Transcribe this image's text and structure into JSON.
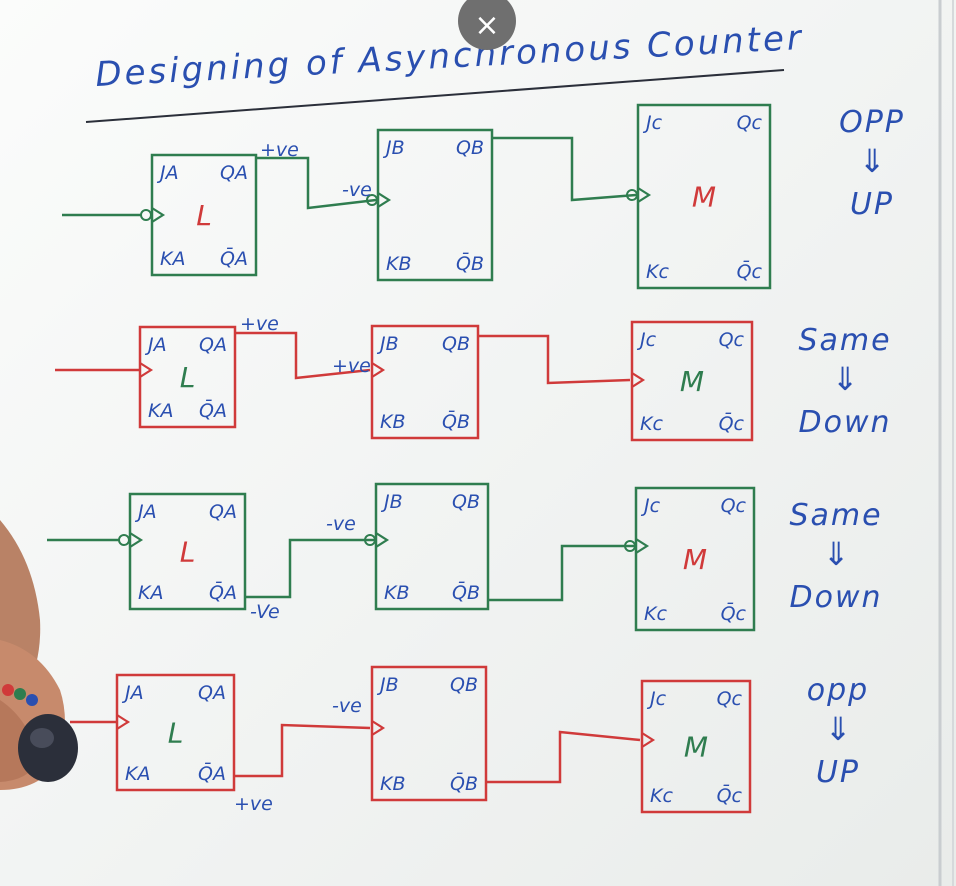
{
  "title": "Designing of Asynchronous Counter",
  "close_icon": "×",
  "colors": {
    "blue": "#2a4fb0",
    "red": "#d03a3a",
    "green": "#2f7d4f",
    "black": "#2b2f3a"
  },
  "rows": [
    {
      "color": "#2f7d4f",
      "ffA": {
        "j": "JA",
        "k": "KA",
        "q": "QA",
        "qbar": "Q̄A",
        "name": "L",
        "name_color": "#d03a3a"
      },
      "ffB": {
        "j": "JB",
        "k": "KB",
        "q": "QB",
        "qbar": "Q̄B",
        "name": "",
        "name_color": "#d03a3a"
      },
      "ffC": {
        "j": "Jc",
        "k": "Kc",
        "q": "Qc",
        "qbar": "Q̄c",
        "name": "M",
        "name_color": "#d03a3a"
      },
      "edge_label_1": "+ve",
      "edge_label_2": "-ve",
      "result_top": "OPP",
      "result_arrow": "⇓",
      "result_bottom": "UP"
    },
    {
      "color": "#d03a3a",
      "ffA": {
        "j": "JA",
        "k": "KA",
        "q": "QA",
        "qbar": "Q̄A",
        "name": "L",
        "name_color": "#2f7d4f"
      },
      "ffB": {
        "j": "JB",
        "k": "KB",
        "q": "QB",
        "qbar": "Q̄B",
        "name": "",
        "name_color": "#2f7d4f"
      },
      "ffC": {
        "j": "Jc",
        "k": "Kc",
        "q": "Qc",
        "qbar": "Q̄c",
        "name": "M",
        "name_color": "#2f7d4f"
      },
      "edge_label_1": "+ve",
      "edge_label_2": "+ve",
      "result_top": "Same",
      "result_arrow": "⇓",
      "result_bottom": "Down"
    },
    {
      "color": "#2f7d4f",
      "ffA": {
        "j": "JA",
        "k": "KA",
        "q": "QA",
        "qbar": "Q̄A",
        "name": "L",
        "name_color": "#d03a3a"
      },
      "ffB": {
        "j": "JB",
        "k": "KB",
        "q": "QB",
        "qbar": "Q̄B",
        "name": "",
        "name_color": "#d03a3a"
      },
      "ffC": {
        "j": "Jc",
        "k": "Kc",
        "q": "Qc",
        "qbar": "Q̄c",
        "name": "M",
        "name_color": "#d03a3a"
      },
      "edge_label_1": "-ve",
      "edge_label_2": "-Ve",
      "result_top": "Same",
      "result_arrow": "⇓",
      "result_bottom": "Down"
    },
    {
      "color": "#d03a3a",
      "ffA": {
        "j": "JA",
        "k": "KA",
        "q": "QA",
        "qbar": "Q̄A",
        "name": "L",
        "name_color": "#2f7d4f"
      },
      "ffB": {
        "j": "JB",
        "k": "KB",
        "q": "QB",
        "qbar": "Q̄B",
        "name": "",
        "name_color": "#2f7d4f"
      },
      "ffC": {
        "j": "Jc",
        "k": "Kc",
        "q": "Qc",
        "qbar": "Q̄c",
        "name": "M",
        "name_color": "#2f7d4f"
      },
      "edge_label_1": "-ve",
      "edge_label_2": "+ve",
      "result_top": "opp",
      "result_arrow": "⇓",
      "result_bottom": "UP"
    }
  ]
}
